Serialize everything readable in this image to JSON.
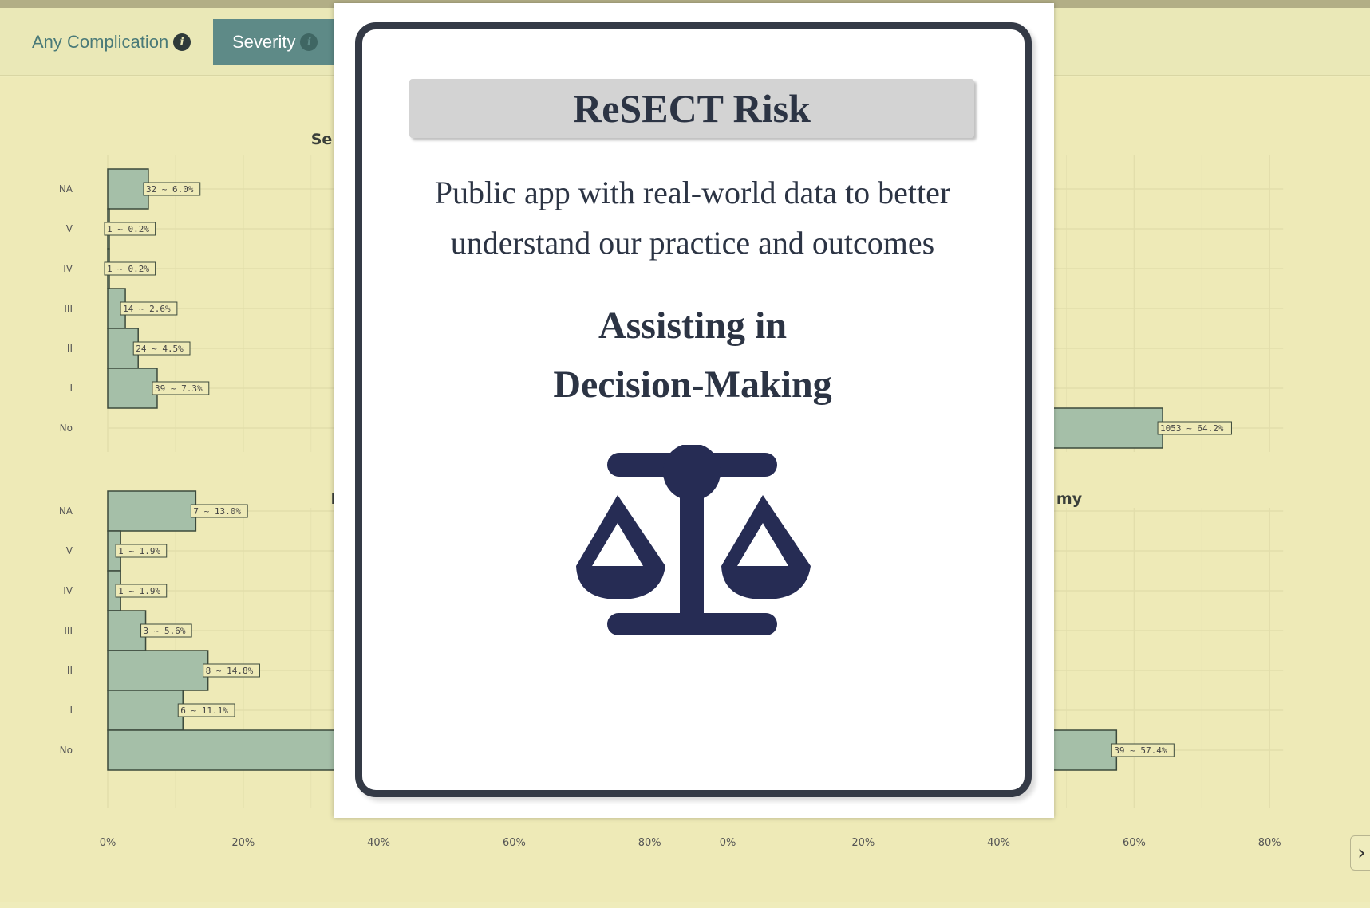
{
  "tabs": [
    {
      "label": "Any Complication",
      "info_icon": "info-icon"
    },
    {
      "label": "Severity",
      "info_icon": "info-icon",
      "active": true
    }
  ],
  "modal": {
    "title": "ReSECT Risk",
    "subtitle_line1": "Public app with real-world data to better",
    "subtitle_line2": "understand our practice and outcomes",
    "heading_line1": "Assisting in",
    "heading_line2": "Decision-Making",
    "icon": "balance-scale-icon"
  },
  "colors": {
    "page_bg": "#eeeab7",
    "bar_fill": "#a5bfa8",
    "active_tab": "#5e8a87",
    "icon_navy": "#262c54",
    "modal_border": "#343a46"
  },
  "chart_data": [
    {
      "type": "bar",
      "orientation": "horizontal",
      "title": "Se",
      "categories": [
        "NA",
        "V",
        "IV",
        "III",
        "II",
        "I",
        "No"
      ],
      "values": [
        6.0,
        0.2,
        0.2,
        2.6,
        4.5,
        7.3,
        null
      ],
      "labels": [
        "32 ~ 6.0%",
        "1 ~ 0.2%",
        "1 ~ 0.2%",
        "14 ~ 2.6%",
        "24 ~ 4.5%",
        "39 ~ 7.3%",
        ""
      ],
      "xlim": [
        0,
        80
      ]
    },
    {
      "type": "bar",
      "orientation": "horizontal",
      "title": "",
      "categories": [
        "NA",
        "V",
        "IV",
        "III",
        "II",
        "I",
        "No"
      ],
      "values": [
        null,
        null,
        null,
        null,
        null,
        null,
        64.2
      ],
      "labels": [
        "",
        "",
        "",
        "",
        "",
        "",
        "1053 ~ 64.2%"
      ],
      "xlim": [
        0,
        80
      ]
    },
    {
      "type": "bar",
      "orientation": "horizontal",
      "title": "I",
      "categories": [
        "NA",
        "V",
        "IV",
        "III",
        "II",
        "I",
        "No"
      ],
      "values": [
        13.0,
        1.9,
        1.9,
        5.6,
        14.8,
        11.1,
        52.0
      ],
      "labels": [
        "7 ~ 13.0%",
        "1 ~ 1.9%",
        "1 ~ 1.9%",
        "3 ~ 5.6%",
        "8 ~ 14.8%",
        "6 ~ 11.1%",
        ""
      ],
      "xticks": [
        "0%",
        "20%",
        "40%",
        "60%",
        "80%"
      ],
      "xlim": [
        0,
        80
      ]
    },
    {
      "type": "bar",
      "orientation": "horizontal",
      "title": "my",
      "categories": [
        "NA",
        "V",
        "IV",
        "III",
        "II",
        "I",
        "No"
      ],
      "values": [
        null,
        null,
        null,
        null,
        null,
        null,
        57.4
      ],
      "labels": [
        "",
        "",
        "",
        "",
        "",
        "",
        "39 ~ 57.4%"
      ],
      "xticks": [
        "0%",
        "20%",
        "40%",
        "60%",
        "80%"
      ],
      "xlim": [
        0,
        80
      ]
    }
  ]
}
